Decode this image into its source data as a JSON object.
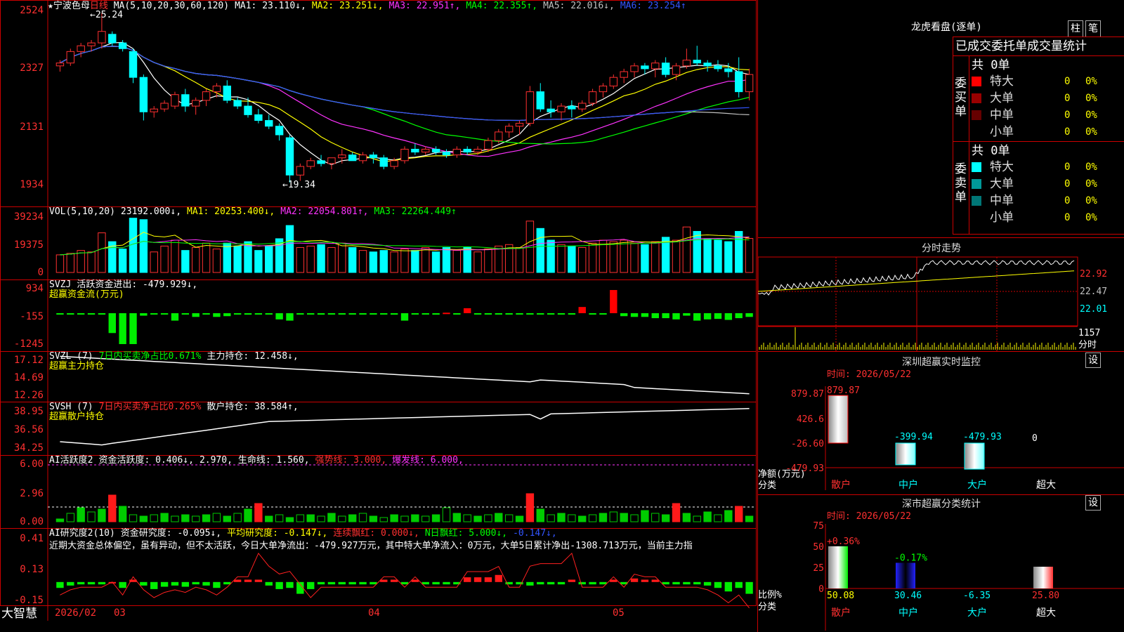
{
  "stock": {
    "name": "宁波色母",
    "period": "日线",
    "star": "★"
  },
  "price_panel": {
    "ma_legend": [
      {
        "text": "MA(5,10,20,30,60,120)",
        "color": "#ffffff"
      },
      {
        "text": "MA1: 23.110↓,",
        "color": "#ffffff"
      },
      {
        "text": "MA2: 23.251↓,",
        "color": "#ffff00"
      },
      {
        "text": "MA3: 22.951↑,",
        "color": "#ff33ff"
      },
      {
        "text": "MA4: 22.355↑,",
        "color": "#00ff00"
      },
      {
        "text": "MA5: 22.016↓,",
        "color": "#c0c0c0"
      },
      {
        "text": "MA6: 23.254↑",
        "color": "#3355ff"
      }
    ],
    "y_ticks": [
      "2524",
      "2327",
      "2131",
      "1934"
    ],
    "high_label": "25.24",
    "low_label": "19.34"
  },
  "vol_panel": {
    "legend": [
      {
        "text": "VOL(5,10,20)",
        "color": "#ffffff"
      },
      {
        "text": "23192.000↓,",
        "color": "#ffffff"
      },
      {
        "text": "MA1: 20253.400↓,",
        "color": "#ffff00"
      },
      {
        "text": "MA2: 22054.801↑,",
        "color": "#ff33ff"
      },
      {
        "text": "MA3: 22264.449↑",
        "color": "#00ff00"
      }
    ],
    "y_ticks": [
      "39234",
      "19375",
      "0"
    ]
  },
  "svzj_panel": {
    "legend": [
      {
        "text": "SVZJ",
        "color": "#ffffff"
      },
      {
        "text": "活跃资金进出: -479.929↓,",
        "color": "#ffffff"
      }
    ],
    "subtitle": "超赢资金流(万元)",
    "y_ticks": [
      "934",
      "-155",
      "-1245"
    ]
  },
  "svzl_panel": {
    "legend": [
      {
        "text": "SVZL (7)",
        "color": "#ffffff"
      },
      {
        "text": "7日内买卖净占比0.671%",
        "color": "#00ff00"
      },
      {
        "text": "主力持仓: 12.458↓,",
        "color": "#ffffff"
      }
    ],
    "subtitle": "超赢主力持仓",
    "y_ticks": [
      "17.12",
      "14.69",
      "12.26"
    ]
  },
  "svsh_panel": {
    "legend": [
      {
        "text": "SVSH (7)",
        "color": "#ffffff"
      },
      {
        "text": "7日内买卖净占比0.265%",
        "color": "#ff3030"
      },
      {
        "text": "散户持仓: 38.584↑,",
        "color": "#ffffff"
      }
    ],
    "subtitle": "超赢散户持仓",
    "y_ticks": [
      "38.95",
      "36.56",
      "34.25"
    ]
  },
  "ai_active_panel": {
    "legend": [
      {
        "text": "AI活跃度2",
        "color": "#ffffff"
      },
      {
        "text": "资金活跃度: 0.406↓,",
        "color": "#ffffff"
      },
      {
        "text": "2.970,",
        "color": "#ffffff"
      },
      {
        "text": "生命线: 1.560,",
        "color": "#ffffff"
      },
      {
        "text": "强势线: 3.000,",
        "color": "#ff3030"
      },
      {
        "text": "爆发线: 6.000,",
        "color": "#ff33ff"
      }
    ],
    "y_ticks": [
      "6.00",
      "2.96",
      "0.00"
    ]
  },
  "ai_research_panel": {
    "legend": [
      {
        "text": "AI研究度2(10)",
        "color": "#ffffff"
      },
      {
        "text": "资金研究度: -0.095↓,",
        "color": "#ffffff"
      },
      {
        "text": "平均研究度: -0.147↓,",
        "color": "#ffff00"
      },
      {
        "text": "连续飘红: 0.000↓,",
        "color": "#ff3030"
      },
      {
        "text": "N日飘红: 5.000↓,",
        "color": "#00ff00"
      },
      {
        "text": "-0.147↓,",
        "color": "#3355ff"
      }
    ],
    "comment": "近期大资金总体偏空，虽有异动，但不太活跃，今日大单净流出：-479.927万元，其中特大单净流入：0万元，大单5日累计净出-1308.713万元，当前主力指",
    "y_ticks": [
      "0.41",
      "0.13",
      "-0.15"
    ]
  },
  "x_axis": {
    "brand": "大智慧",
    "labels": [
      "2026/02",
      "03",
      "04",
      "05"
    ]
  },
  "longhu": {
    "title": "龙虎看盘(逐单)",
    "btn_bar": "柱",
    "btn_stroke": "笔",
    "header": "已成交委托单成交量统计",
    "buy_label": "委买单",
    "sell_label": "委卖单",
    "buy_total": "共 0单",
    "sell_total": "共 0单",
    "buy_rows": [
      {
        "name": "特大",
        "count": "0",
        "pct": "0%",
        "color": "#ff0000"
      },
      {
        "name": "大单",
        "count": "0",
        "pct": "0%",
        "color": "#990000"
      },
      {
        "name": "中单",
        "count": "0",
        "pct": "0%",
        "color": "#660000"
      },
      {
        "name": "小单",
        "count": "0",
        "pct": "0%",
        "color": ""
      }
    ],
    "sell_rows": [
      {
        "name": "特大",
        "count": "0",
        "pct": "0%",
        "color": "#00ffff"
      },
      {
        "name": "大单",
        "count": "0",
        "pct": "0%",
        "color": "#009999"
      },
      {
        "name": "中单",
        "count": "0",
        "pct": "0%",
        "color": "#007777"
      },
      {
        "name": "小单",
        "count": "0",
        "pct": "0%",
        "color": ""
      }
    ]
  },
  "intraday": {
    "title": "分时走势",
    "y_ticks": [
      "22.92",
      "22.47",
      "22.01"
    ],
    "vol_tick": "1157",
    "vol_unit": "分时"
  },
  "monitor": {
    "title": "深圳超赢实时监控",
    "setting_btn": "设",
    "time": "时间: 2026/05/22",
    "y_ticks": [
      "879.87",
      "426.6",
      "-26.60",
      "-479.93"
    ],
    "ylabel": "净额(万元)",
    "xlabel": "分类",
    "categories": [
      "散户",
      "中户",
      "大户",
      "超大"
    ],
    "values": [
      879.87,
      -399.94,
      -479.93,
      0
    ],
    "value_labels": [
      "879.87",
      "-399.94",
      "-479.93",
      "0"
    ]
  },
  "classify": {
    "title": "深市超赢分类统计",
    "setting_btn": "设",
    "time": "时间: 2026/05/22",
    "y_ticks": [
      "75",
      "50",
      "25",
      "0"
    ],
    "ylabel": "比例%",
    "xlabel": "分类",
    "categories": [
      "散户",
      "中户",
      "大户",
      "超大"
    ],
    "values": [
      50.08,
      30.46,
      -6.35,
      25.8
    ],
    "value_labels": [
      "50.08",
      "30.46",
      "-6.35",
      "25.80"
    ],
    "change_labels": [
      "+0.36%",
      "-0.17%",
      "",
      ""
    ]
  },
  "chart_data": {
    "type": "candlestick",
    "dates": [
      "2026/02",
      "03",
      "04",
      "05"
    ],
    "close_first": 23.4,
    "high": 25.24,
    "low": 19.34,
    "candles": [
      [
        23.4,
        23.6,
        23.2,
        23.5
      ],
      [
        23.5,
        24.0,
        23.4,
        23.9
      ],
      [
        23.9,
        24.2,
        23.7,
        24.1
      ],
      [
        24.1,
        24.3,
        23.9,
        24.2
      ],
      [
        24.2,
        25.24,
        24.0,
        24.6
      ],
      [
        24.5,
        24.6,
        24.1,
        24.2
      ],
      [
        24.2,
        24.3,
        23.9,
        24.0
      ],
      [
        23.9,
        24.0,
        22.8,
        23.0
      ],
      [
        23.0,
        23.1,
        21.5,
        21.8
      ],
      [
        21.8,
        22.0,
        21.6,
        21.9
      ],
      [
        21.9,
        22.2,
        21.8,
        22.1
      ],
      [
        22.0,
        22.5,
        21.9,
        22.4
      ],
      [
        22.4,
        22.6,
        21.8,
        22.0
      ],
      [
        22.0,
        22.3,
        21.7,
        22.2
      ],
      [
        22.2,
        22.6,
        22.0,
        22.5
      ],
      [
        22.5,
        22.8,
        22.3,
        22.7
      ],
      [
        22.7,
        22.9,
        22.1,
        22.2
      ],
      [
        22.2,
        22.3,
        21.9,
        22.0
      ],
      [
        22.0,
        22.3,
        21.6,
        21.7
      ],
      [
        21.7,
        21.9,
        21.4,
        21.5
      ],
      [
        21.5,
        21.7,
        21.2,
        21.3
      ],
      [
        21.3,
        21.4,
        20.8,
        21.0
      ],
      [
        20.9,
        21.0,
        19.34,
        19.6
      ],
      [
        19.6,
        20.0,
        19.4,
        19.9
      ],
      [
        19.9,
        20.2,
        19.8,
        20.1
      ],
      [
        20.1,
        20.3,
        19.9,
        20.0
      ],
      [
        20.0,
        20.2,
        19.8,
        20.2
      ],
      [
        20.2,
        20.5,
        20.0,
        20.3
      ],
      [
        20.3,
        20.4,
        20.1,
        20.1
      ],
      [
        20.1,
        20.4,
        20.0,
        20.3
      ],
      [
        20.3,
        20.4,
        20.0,
        20.2
      ],
      [
        20.2,
        20.3,
        19.8,
        19.9
      ],
      [
        19.9,
        20.2,
        19.8,
        20.1
      ],
      [
        20.1,
        20.6,
        20.0,
        20.5
      ],
      [
        20.5,
        20.7,
        20.3,
        20.4
      ],
      [
        20.4,
        20.6,
        20.3,
        20.5
      ],
      [
        20.5,
        20.6,
        20.3,
        20.4
      ],
      [
        20.4,
        20.5,
        20.2,
        20.3
      ],
      [
        20.3,
        20.6,
        20.2,
        20.5
      ],
      [
        20.5,
        20.6,
        20.3,
        20.4
      ],
      [
        20.4,
        20.6,
        20.3,
        20.5
      ],
      [
        20.5,
        20.9,
        20.4,
        20.8
      ],
      [
        20.8,
        21.2,
        20.7,
        21.1
      ],
      [
        21.1,
        21.4,
        20.9,
        21.3
      ],
      [
        21.3,
        21.5,
        21.0,
        21.4
      ],
      [
        21.4,
        22.7,
        21.3,
        22.5
      ],
      [
        22.5,
        22.8,
        21.8,
        21.9
      ],
      [
        21.9,
        22.2,
        21.6,
        21.8
      ],
      [
        21.8,
        22.1,
        21.5,
        22.0
      ],
      [
        22.0,
        22.2,
        21.6,
        21.9
      ],
      [
        21.9,
        22.2,
        21.8,
        22.1
      ],
      [
        22.1,
        22.6,
        22.0,
        22.5
      ],
      [
        22.5,
        22.8,
        22.3,
        22.7
      ],
      [
        22.7,
        23.1,
        22.6,
        23.0
      ],
      [
        23.0,
        23.3,
        22.8,
        23.2
      ],
      [
        23.2,
        23.5,
        23.0,
        23.4
      ],
      [
        23.4,
        23.5,
        23.1,
        23.3
      ],
      [
        23.3,
        23.6,
        23.0,
        23.5
      ],
      [
        23.5,
        23.7,
        23.0,
        23.1
      ],
      [
        23.1,
        23.5,
        22.9,
        23.4
      ],
      [
        23.4,
        24.0,
        23.3,
        23.6
      ],
      [
        23.6,
        24.1,
        23.4,
        23.5
      ],
      [
        23.5,
        23.6,
        23.2,
        23.4
      ],
      [
        23.4,
        23.6,
        23.2,
        23.3
      ],
      [
        23.3,
        23.5,
        23.0,
        23.2
      ],
      [
        23.2,
        23.7,
        22.3,
        22.5
      ],
      [
        22.5,
        23.3,
        22.2,
        23.1
      ]
    ],
    "volume": [
      12000,
      13000,
      15000,
      14000,
      27000,
      21000,
      16000,
      37000,
      36000,
      14000,
      18000,
      22000,
      15000,
      17000,
      20000,
      16000,
      20000,
      18000,
      21000,
      15000,
      18000,
      23000,
      32000,
      17000,
      18000,
      19000,
      17000,
      20000,
      17000,
      15000,
      14000,
      15000,
      14000,
      16000,
      15000,
      17000,
      14000,
      17000,
      15000,
      17000,
      14000,
      16000,
      18000,
      19000,
      17000,
      35000,
      30000,
      22000,
      19000,
      18000,
      17000,
      20000,
      22000,
      21000,
      22000,
      20000,
      19000,
      21000,
      24000,
      22000,
      31000,
      28000,
      23000,
      22000,
      21000,
      28000,
      23192
    ],
    "svzj": [
      -20,
      -20,
      -30,
      -40,
      -20,
      -800,
      -1245,
      -1245,
      -100,
      -20,
      -20,
      -300,
      -20,
      -150,
      -20,
      -150,
      -120,
      -20,
      -60,
      -20,
      -30,
      -250,
      -300,
      -20,
      -20,
      -60,
      -20,
      -20,
      -20,
      -20,
      -20,
      -20,
      -60,
      -300,
      -20,
      -20,
      -60,
      20,
      -50,
      200,
      -20,
      -20,
      -20,
      -20,
      -40,
      -40,
      -40,
      -20,
      -20,
      -20,
      250,
      -20,
      -40,
      934,
      -120,
      -150,
      -150,
      -200,
      -200,
      -250,
      -100,
      -300,
      -250,
      -230,
      -270,
      -200,
      -150,
      -20,
      -180,
      -200,
      -180,
      -150,
      -150,
      -130,
      -100,
      -120,
      -100,
      -100,
      -479.93
    ],
    "ylim_price": [
      18.8,
      25.4
    ]
  }
}
